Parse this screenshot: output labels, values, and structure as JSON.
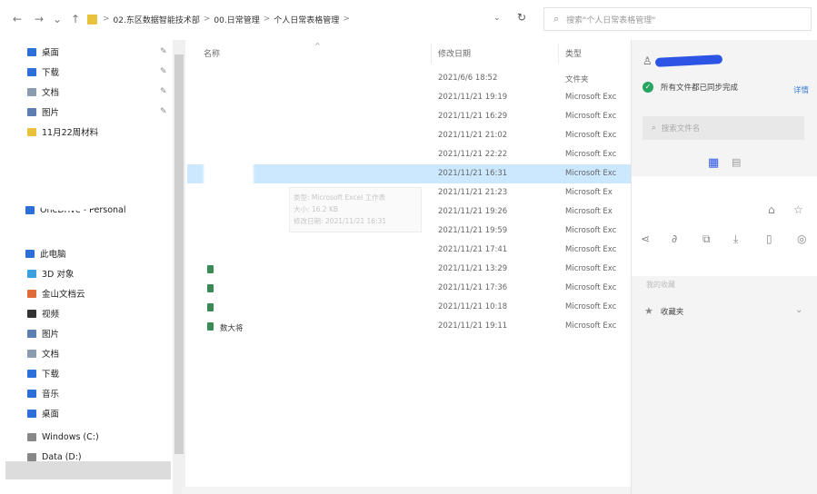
{
  "address": {
    "crumbs": [
      "02.东区数据智能技术部",
      "00.日常管理",
      "个人日常表格管理"
    ],
    "separator": ">",
    "search_placeholder": "搜索\"个人日常表格管理\""
  },
  "nav": {
    "items": [
      {
        "label": "桌面",
        "icon": "desktop-icon",
        "color": "#2d6fd8"
      },
      {
        "label": "下载",
        "icon": "download-icon",
        "color": "#2d6fd8"
      },
      {
        "label": "文档",
        "icon": "document-icon",
        "color": "#8a9bb0"
      },
      {
        "label": "图片",
        "icon": "picture-icon",
        "color": "#5a7fb0"
      },
      {
        "label": "11月22周材料",
        "icon": "folder-icon",
        "color": "#e9c13b"
      },
      {
        "label": "OneDrive - Personal",
        "icon": "cloud-icon",
        "color": "#2d6fd8"
      },
      {
        "label": "此电脑",
        "icon": "computer-icon",
        "color": "#2d6fd8"
      },
      {
        "label": "3D 对象",
        "icon": "3d-objects-icon",
        "color": "#3aa0e0"
      },
      {
        "label": "金山文档云",
        "icon": "cloud-drive-icon",
        "color": "#e06c3a"
      },
      {
        "label": "视频",
        "icon": "video-icon",
        "color": "#333333"
      },
      {
        "label": "图片",
        "icon": "picture-icon",
        "color": "#5a7fb0"
      },
      {
        "label": "文档",
        "icon": "document-icon",
        "color": "#8a9bb0"
      },
      {
        "label": "下载",
        "icon": "download-icon",
        "color": "#2d6fd8"
      },
      {
        "label": "音乐",
        "icon": "music-icon",
        "color": "#2d6fd8"
      },
      {
        "label": "桌面",
        "icon": "desktop-icon",
        "color": "#2d6fd8"
      },
      {
        "label": "Windows (C:)",
        "icon": "drive-icon",
        "color": "#888888"
      },
      {
        "label": "Data (D:)",
        "icon": "drive-icon",
        "color": "#888888"
      }
    ]
  },
  "list": {
    "columns": {
      "name": "名称",
      "date": "修改日期",
      "type": "类型"
    },
    "rows": [
      {
        "date": "2021/6/6 18:52",
        "type": "文件夹"
      },
      {
        "date": "2021/11/21 19:19",
        "type": "Microsoft Exc"
      },
      {
        "date": "2021/11/21 16:29",
        "type": "Microsoft Exc"
      },
      {
        "date": "2021/11/21 21:02",
        "type": "Microsoft Exc"
      },
      {
        "date": "2021/11/21 22:22",
        "type": "Microsoft Exc"
      },
      {
        "date": "2021/11/21 16:31",
        "type": "Microsoft Exc",
        "selected": true
      },
      {
        "date": "2021/11/21 21:23",
        "type": "Microsoft Ex"
      },
      {
        "date": "2021/11/21 19:26",
        "type": "Microsoft Ex"
      },
      {
        "date": "2021/11/21 19:59",
        "type": "Microsoft Exc"
      },
      {
        "date": "2021/11/21 17:41",
        "type": "Microsoft Exc"
      },
      {
        "date": "2021/11/21 13:29",
        "type": "Microsoft Exc"
      },
      {
        "date": "2021/11/21 17:36",
        "type": "Microsoft Exc"
      },
      {
        "date": "2021/11/21 10:18",
        "type": "Microsoft Exc"
      },
      {
        "date": "2021/11/21 19:11",
        "type": "Microsoft Exc"
      }
    ],
    "last_name": "数大将",
    "tooltip": {
      "line1": "类型: Microsoft Excel 工作表",
      "line2": "大小: 16.2 KB",
      "line3": "修改日期: 2021/11/21 16:31"
    }
  },
  "panel": {
    "sync_text": "所有文件都已同步完成",
    "sync_detail": "详情",
    "search_placeholder": "搜索文件名",
    "favorites_label": "我的收藏",
    "favorites_item": "收藏夹",
    "accent": "#2c55e6",
    "sync_color": "#25a55f"
  }
}
